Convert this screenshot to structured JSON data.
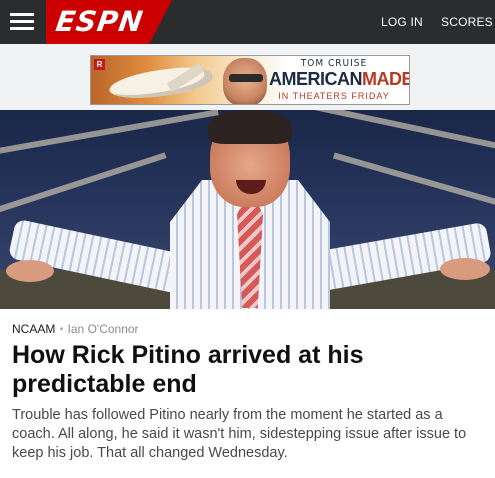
{
  "header": {
    "menu_icon": "hamburger-menu-icon",
    "logo_text": "ESPN",
    "login_label": "LOG IN",
    "scores_label": "SCORES",
    "bar_color": "#2b2c2d",
    "brand_color": "#cc0000"
  },
  "ad": {
    "rating": "R",
    "line1": "TOM CRUISE",
    "line2_a": "AMERICAN",
    "line2_b": "MADE",
    "line3": "IN THEATERS FRIDAY"
  },
  "hero": {
    "image": "photo of a coach in a striped dress shirt and tie with arms spread wide on a basketball court"
  },
  "article": {
    "section": "NCAAM",
    "separator": "•",
    "author": "Ian O'Connor",
    "headline": "How Rick Pitino arrived at his predictable end",
    "summary": "Trouble has followed Pitino nearly from the moment he started as a coach. All along, he said it wasn't him, sidestepping issue after issue to keep his job. That all changed Wednesday."
  }
}
